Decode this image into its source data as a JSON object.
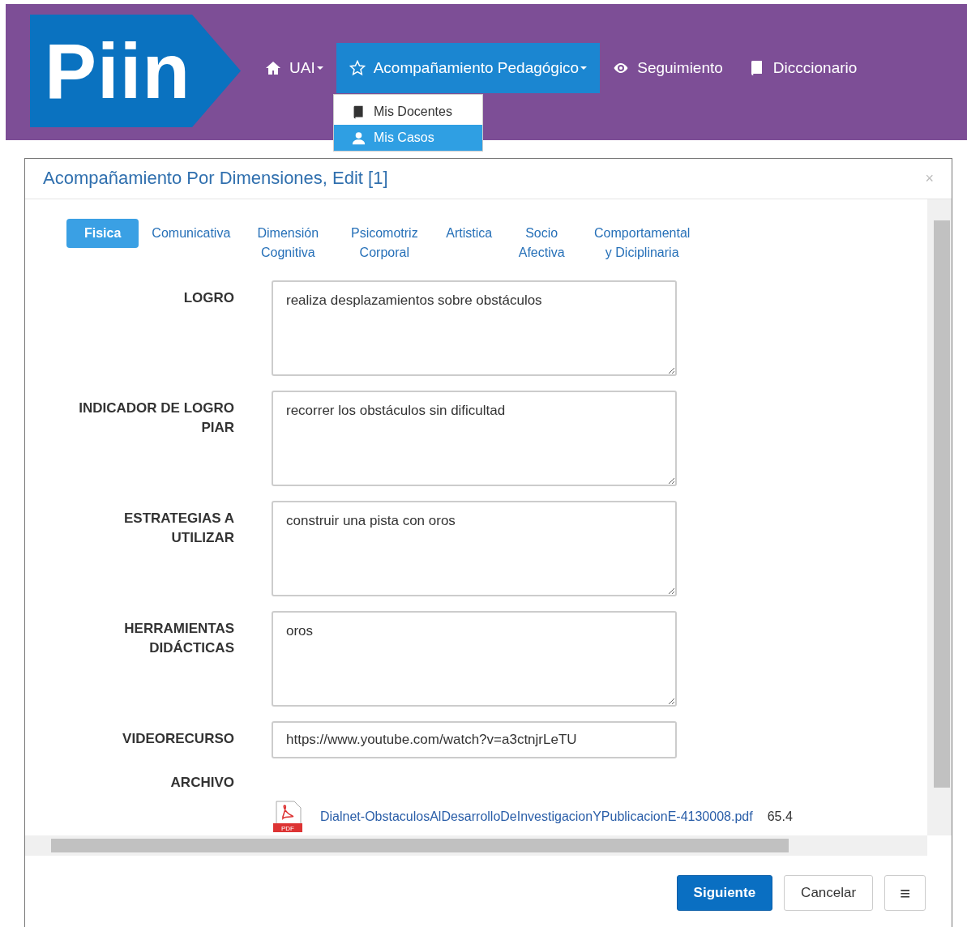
{
  "navbar": {
    "logo": "Piin",
    "items": [
      {
        "label": "UAI",
        "dropdown": true,
        "selected": false
      },
      {
        "label": "Acompañamiento Pedagógico",
        "dropdown": true,
        "selected": true
      },
      {
        "label": "Seguimiento",
        "dropdown": false,
        "selected": false
      },
      {
        "label": "Dicccionario",
        "dropdown": false,
        "selected": false
      }
    ],
    "dropdown_menu": [
      {
        "label": "Mis Docentes",
        "selected": false
      },
      {
        "label": "Mis Casos",
        "selected": true
      }
    ]
  },
  "modal": {
    "title": "Acompañamiento Por Dimensiones, Edit [1]",
    "close": "×",
    "tabs": [
      {
        "label": "Fisica",
        "selected": true
      },
      {
        "label": "Comunicativa",
        "selected": false
      },
      {
        "label": "Dimensión Cognitiva",
        "selected": false
      },
      {
        "label": "Psicomotriz Corporal",
        "selected": false
      },
      {
        "label": "Artistica",
        "selected": false
      },
      {
        "label": "Socio Afectiva",
        "selected": false
      },
      {
        "label": "Comportamental y Diciplinaria",
        "selected": false
      }
    ],
    "fields": [
      {
        "label": "LOGRO",
        "kind": "textarea",
        "value": "realiza desplazamientos sobre obstáculos"
      },
      {
        "label": "INDICADOR DE LOGRO PIAR",
        "kind": "textarea",
        "value": "recorrer los obstáculos sin dificultad"
      },
      {
        "label": "ESTRATEGIAS A UTILIZAR",
        "kind": "textarea",
        "value": "construir una pista con oros"
      },
      {
        "label": "HERRAMIENTAS DIDÁCTICAS",
        "kind": "textarea",
        "value": "oros"
      },
      {
        "label": "VIDEORECURSO",
        "kind": "input",
        "value": "https://www.youtube.com/watch?v=a3ctnjrLeTU"
      },
      {
        "label": "ARCHIVO",
        "kind": "file",
        "icon_text": "PDF",
        "file_name": "Dialnet-ObstaculosAlDesarrolloDeInvestigacionYPublicacionE-4130008.pdf",
        "file_size": "65.4"
      }
    ],
    "buttons": [
      {
        "label": "Siguiente",
        "kind": "primary"
      },
      {
        "label": "Cancelar",
        "kind": "default"
      },
      {
        "label": "≡",
        "kind": "menu"
      }
    ]
  }
}
